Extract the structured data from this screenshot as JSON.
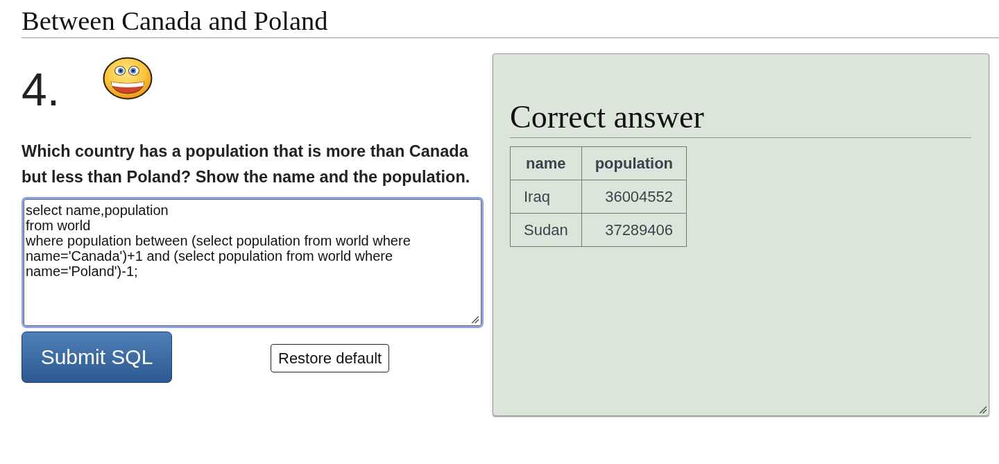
{
  "page": {
    "title": "Between Canada and Poland"
  },
  "question": {
    "number": "4.",
    "text": "Which country has a population that is more than Canada but less than Poland? Show the name and the population."
  },
  "editor": {
    "value": "select name,population\nfrom world\nwhere population between (select population from world where name='Canada')+1 and (select population from world where name='Poland')-1;"
  },
  "buttons": [
    {
      "kind": "primary",
      "label": "Submit SQL"
    },
    {
      "kind": "secondary",
      "label": "Restore default"
    }
  ],
  "result": {
    "heading": "Correct answer",
    "table": {
      "columns": [
        {
          "label": "name",
          "kind": "text"
        },
        {
          "label": "population",
          "kind": "number"
        }
      ],
      "rows": [
        [
          "Iraq",
          "36004552"
        ],
        [
          "Sudan",
          "37289406"
        ]
      ]
    }
  }
}
